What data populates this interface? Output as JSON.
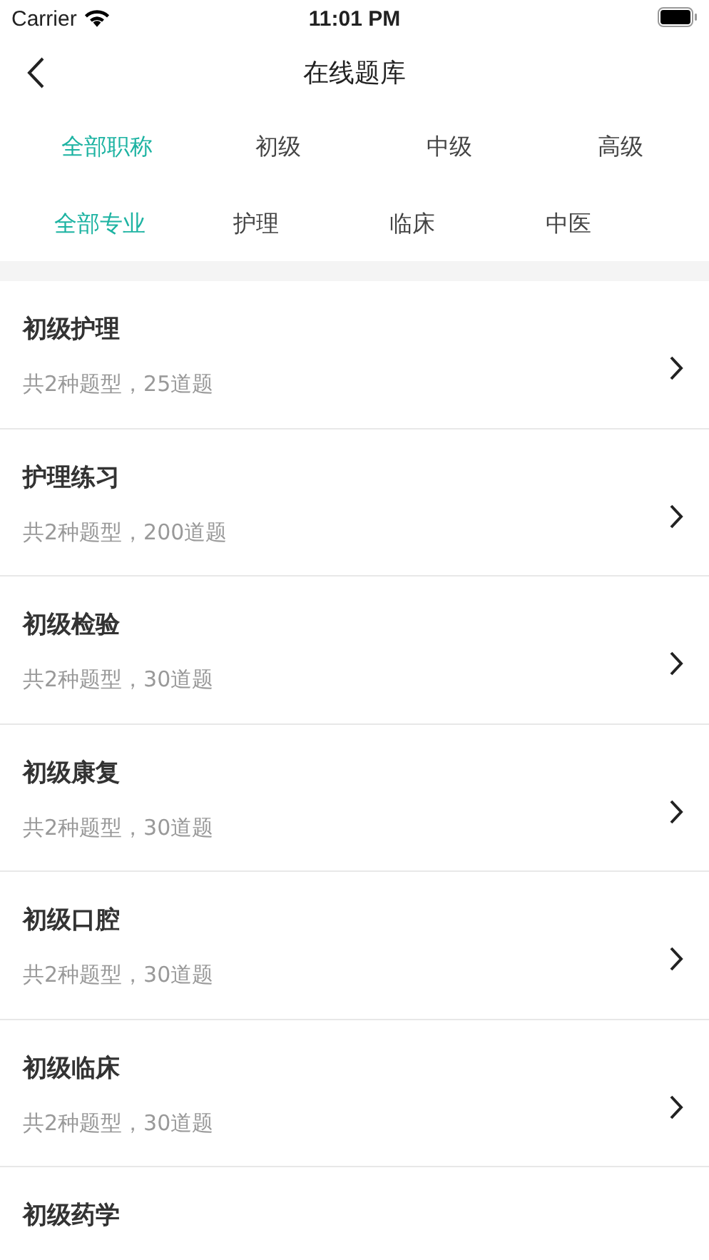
{
  "status_bar": {
    "carrier": "Carrier",
    "time": "11:01 PM"
  },
  "nav": {
    "title": "在线题库"
  },
  "level_tabs": [
    {
      "label": "全部职称",
      "selected": true
    },
    {
      "label": "初级",
      "selected": false
    },
    {
      "label": "中级",
      "selected": false
    },
    {
      "label": "高级",
      "selected": false
    }
  ],
  "specialty_tabs": [
    {
      "label": "全部专业",
      "selected": true
    },
    {
      "label": "护理",
      "selected": false
    },
    {
      "label": "临床",
      "selected": false
    },
    {
      "label": "中医",
      "selected": false
    }
  ],
  "banks": [
    {
      "title": "初级护理",
      "subtitle": "共2种题型，25道题"
    },
    {
      "title": "护理练习",
      "subtitle": "共2种题型，200道题"
    },
    {
      "title": "初级检验",
      "subtitle": "共2种题型，30道题"
    },
    {
      "title": "初级康复",
      "subtitle": "共2种题型，30道题"
    },
    {
      "title": "初级口腔",
      "subtitle": "共2种题型，30道题"
    },
    {
      "title": "初级临床",
      "subtitle": "共2种题型，30道题"
    },
    {
      "title": "初级药学"
    }
  ]
}
